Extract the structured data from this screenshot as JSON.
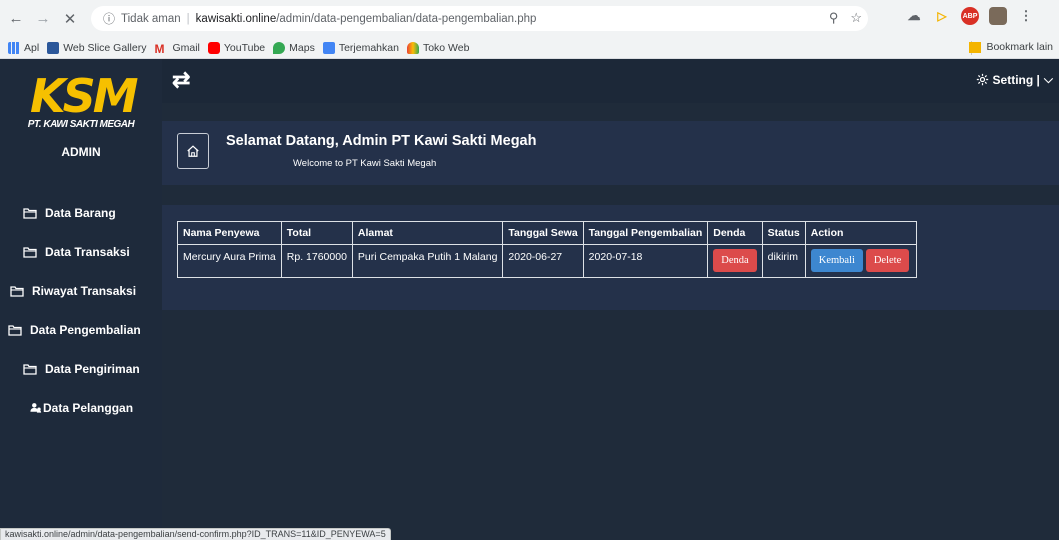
{
  "browser": {
    "insecure_label": "Tidak aman",
    "url_host": "kawisakti.online",
    "url_path": "/admin/data-pengembalian/data-pengembalian.php",
    "bookmarks": [
      {
        "label": "Apl",
        "icon": "apps-grid-icon"
      },
      {
        "label": "Web Slice Gallery",
        "icon": "web-slice-icon"
      },
      {
        "label": "Gmail",
        "icon": "gmail-icon"
      },
      {
        "label": "YouTube",
        "icon": "youtube-icon"
      },
      {
        "label": "Maps",
        "icon": "maps-icon"
      },
      {
        "label": "Terjemahkan",
        "icon": "translate-icon"
      },
      {
        "label": "Toko Web",
        "icon": "webstore-icon"
      }
    ],
    "other_bookmarks": "Bookmark lain",
    "status_url": "kawisakti.online/admin/data-pengembalian/send-confirm.php?ID_TRANS=11&ID_PENYEWA=5"
  },
  "sidebar": {
    "logo_text": "KSM",
    "logo_subtitle": "PT. KAWI SAKTI MEGAH",
    "role": "ADMIN",
    "items": [
      {
        "label": "Data Barang",
        "icon": "folder-icon"
      },
      {
        "label": "Data Transaksi",
        "icon": "folder-icon"
      },
      {
        "label": "Riwayat Transaksi",
        "icon": "folder-icon"
      },
      {
        "label": "Data Pengembalian",
        "icon": "folder-icon"
      },
      {
        "label": "Data Pengiriman",
        "icon": "folder-icon"
      },
      {
        "label": "Data Pelanggan",
        "icon": "users-icon"
      }
    ]
  },
  "topnav": {
    "toggle_icon": "swap-arrows-icon",
    "setting_label": "Setting |"
  },
  "welcome": {
    "title": "Selamat Datang, Admin PT Kawi Sakti Megah",
    "subtitle": "Welcome to PT Kawi Sakti Megah"
  },
  "table": {
    "headers": [
      "Nama Penyewa",
      "Total",
      "Alamat",
      "Tanggal Sewa",
      "Tanggal Pengembalian",
      "Denda",
      "Status",
      "Action"
    ],
    "rows": [
      {
        "nama": "Mercury Aura Prima",
        "total": "Rp. 1760000",
        "alamat": "Puri Cempaka Putih 1 Malang",
        "tanggal_sewa": "2020-06-27",
        "tanggal_pengembalian": "2020-07-18",
        "denda_button": "Denda",
        "status": "dikirim",
        "kembali_button": "Kembali",
        "delete_button": "Delete"
      }
    ]
  },
  "colors": {
    "sidebar_bg": "#1e2a3b",
    "panel_bg": "#24314a",
    "logo_yellow": "#f6c000",
    "danger": "#dc4b4b",
    "primary": "#3d87d0"
  }
}
